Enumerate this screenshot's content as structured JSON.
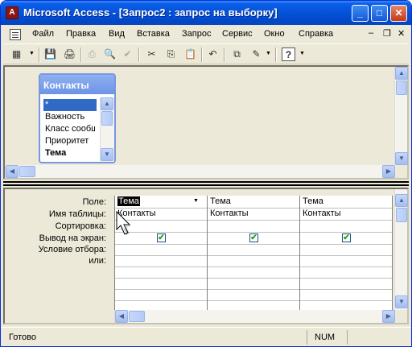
{
  "window": {
    "title": "Microsoft Access - [Запрос2 : запрос на выборку]",
    "app_icon": "access-icon",
    "buttons": {
      "minimize": "_",
      "maximize": "□",
      "close": "✕"
    }
  },
  "menu": {
    "items": [
      "Файл",
      "Правка",
      "Вид",
      "Вставка",
      "Запрос",
      "Сервис",
      "Окно",
      "Справка"
    ],
    "mdi_minimize": "–",
    "mdi_restore": "❐",
    "mdi_close": "✕"
  },
  "toolbar": {
    "icons": [
      "datasheet-view-icon",
      "save-icon",
      "print-preview-icon",
      "print-icon",
      "preview-icon",
      "spelling-icon",
      "cut-icon",
      "copy-icon",
      "paste-icon",
      "undo-icon",
      "query-type-icon",
      "run-icon",
      "help-icon"
    ],
    "glyphs": {
      "view": "▦",
      "save": "💾",
      "print_prev": "🖨",
      "print": "⎙",
      "preview": "🔍",
      "spell": "✔",
      "cut": "✂",
      "copy": "⎘",
      "paste": "📋",
      "undo": "↶",
      "qtype": "⧉",
      "run": "✎",
      "help": "?"
    }
  },
  "table_card": {
    "title": "Контакты",
    "fields": [
      "*",
      "Важность",
      "Класс сообщения",
      "Приоритет",
      "Тема"
    ],
    "selected_index": 0
  },
  "design_grid": {
    "row_labels": [
      "Поле:",
      "Имя таблицы:",
      "Сортировка:",
      "Вывод на экран:",
      "Условие отбора:",
      "или:"
    ],
    "columns": [
      {
        "field": "Тема",
        "table": "Контакты",
        "sort": "",
        "show": true
      },
      {
        "field": "Тема",
        "table": "Контакты",
        "sort": "",
        "show": true
      },
      {
        "field": "Тема",
        "table": "Контакты",
        "sort": "",
        "show": true
      }
    ],
    "check_glyph": "✔"
  },
  "scroll": {
    "up": "▲",
    "down": "▼",
    "left": "◀",
    "right": "▶"
  },
  "status": {
    "text": "Готово",
    "num": "NUM"
  },
  "colors": {
    "titlebar": "#0553d8",
    "selection": "#316ac5",
    "card_title": "#7a96df"
  }
}
